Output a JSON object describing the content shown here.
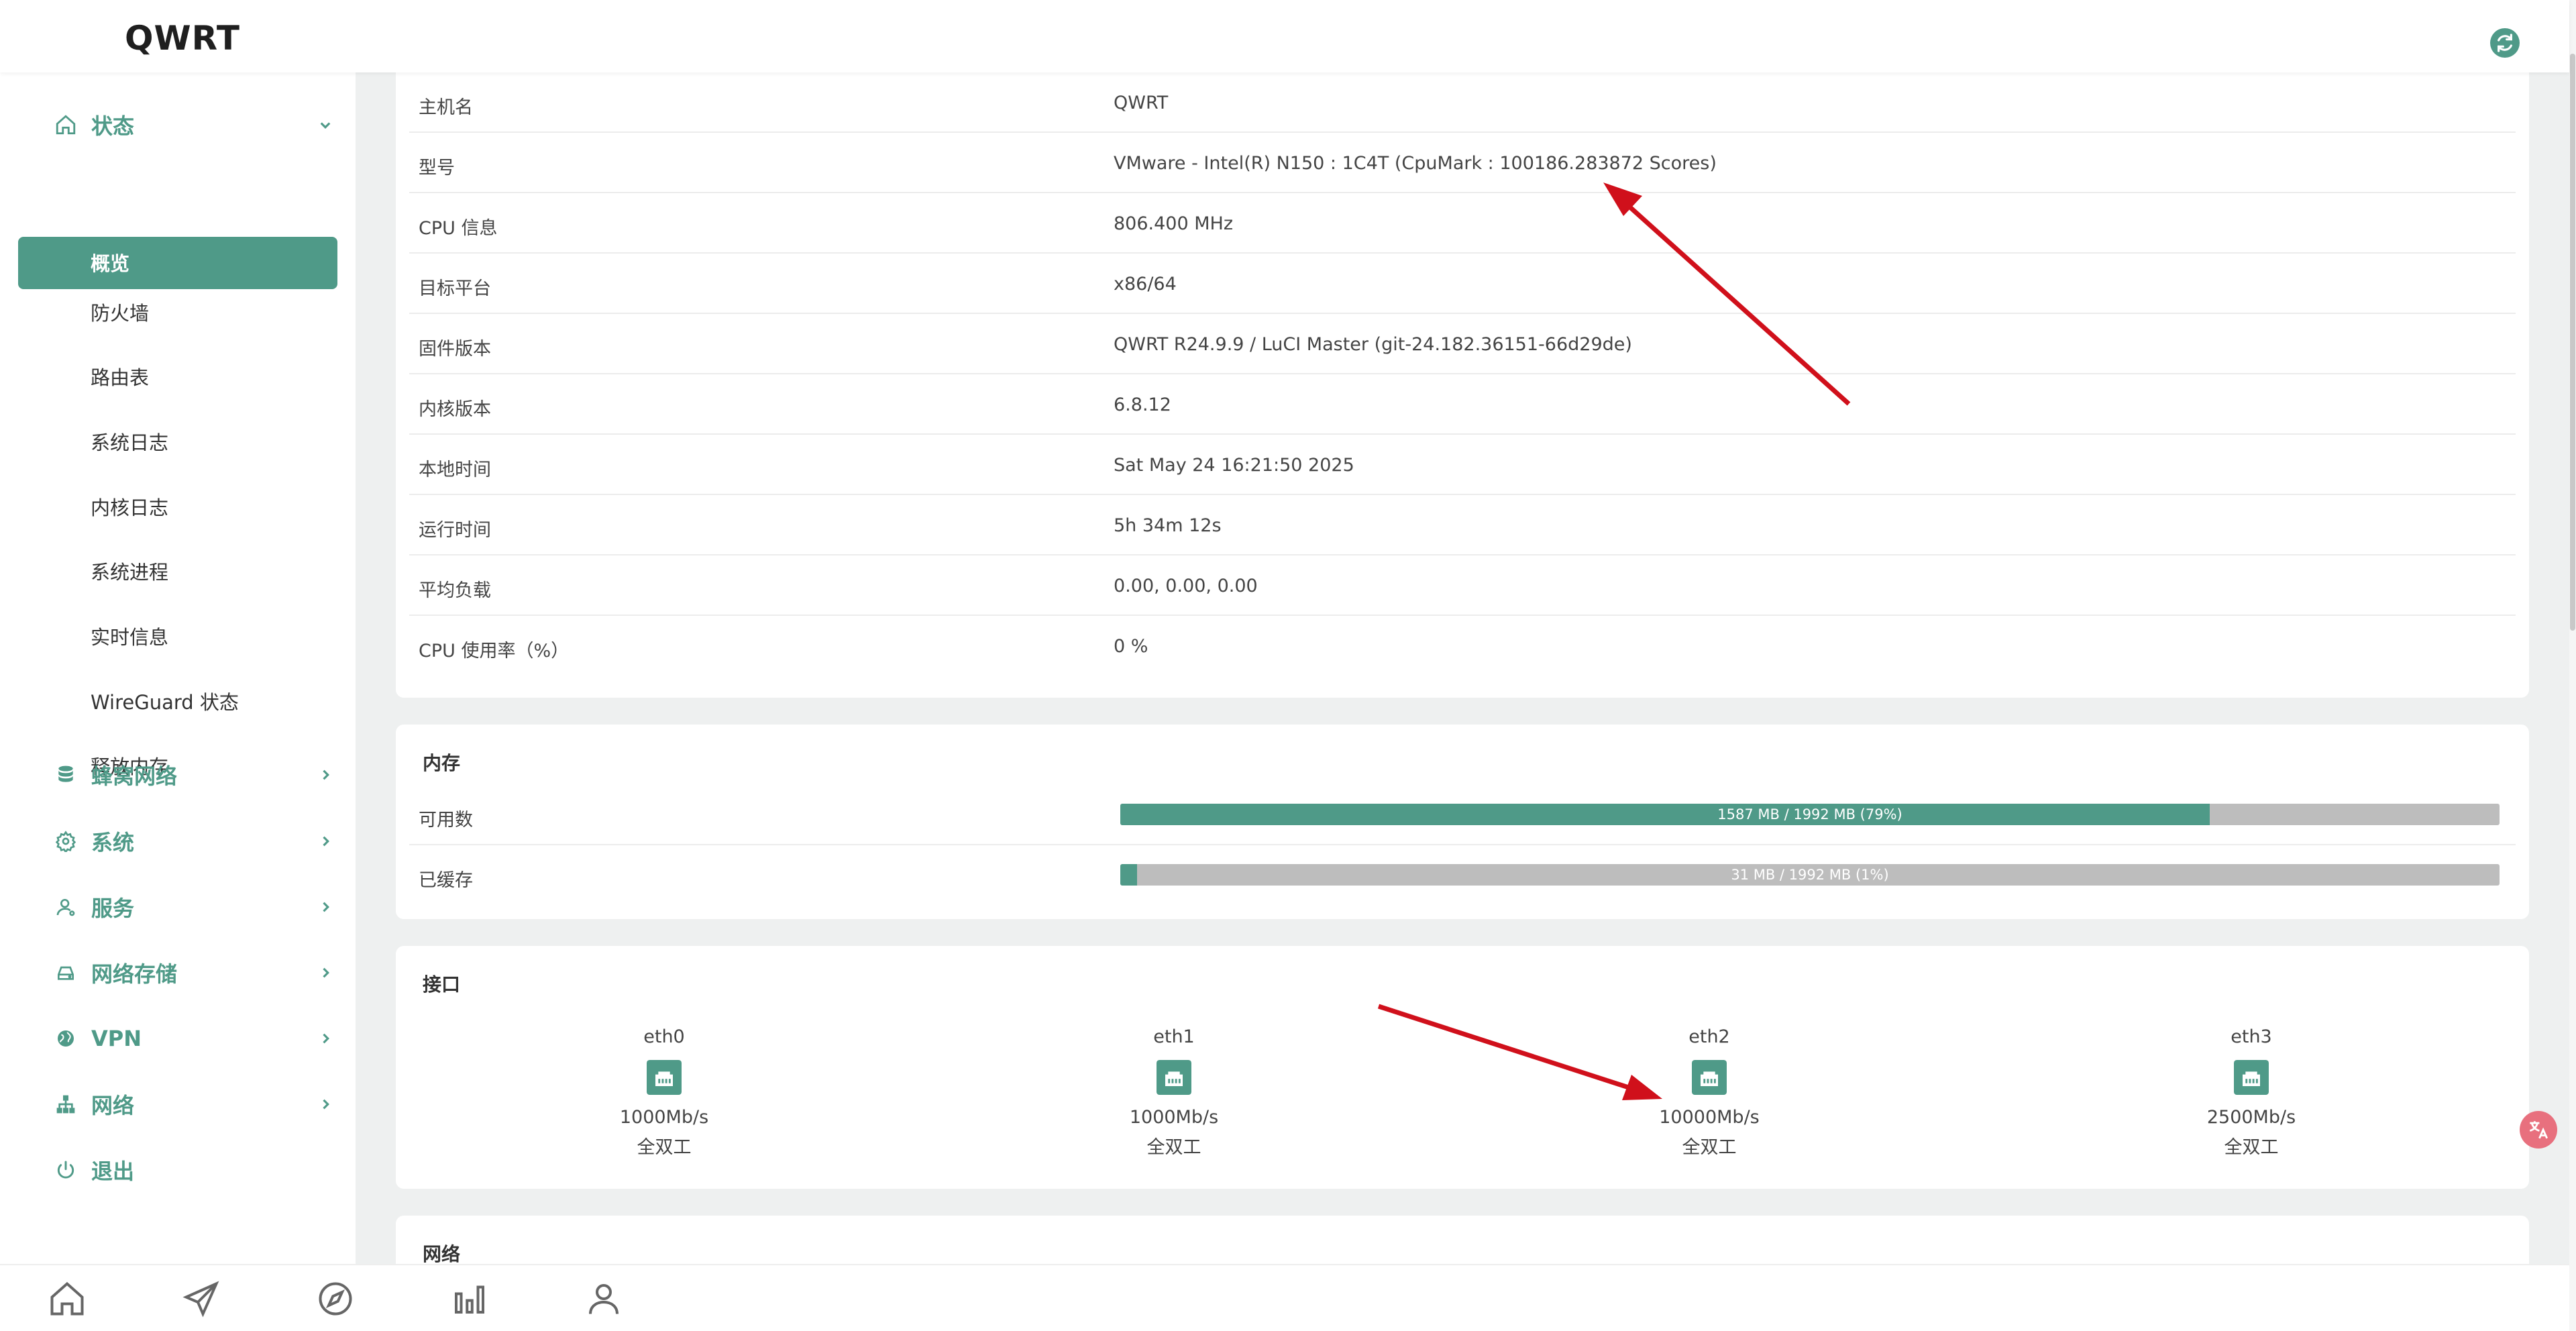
{
  "header": {
    "brand": "QWRT"
  },
  "sidebar": {
    "status_group": "状态",
    "status_items": [
      "概览",
      "防火墙",
      "路由表",
      "系统日志",
      "内核日志",
      "系统进程",
      "实时信息",
      "WireGuard 状态",
      "释放内存"
    ],
    "groups": [
      "蜂窝网络",
      "系统",
      "服务",
      "网络存储",
      "VPN",
      "网络",
      "退出"
    ]
  },
  "system": {
    "rows": [
      {
        "k": "主机名",
        "v": "QWRT"
      },
      {
        "k": "型号",
        "v": "VMware - Intel(R) N150 : 1C4T (CpuMark : 100186.283872 Scores)"
      },
      {
        "k": "CPU 信息",
        "v": "806.400 MHz"
      },
      {
        "k": "目标平台",
        "v": "x86/64"
      },
      {
        "k": "固件版本",
        "v": "QWRT R24.9.9 / LuCI Master (git-24.182.36151-66d29de)"
      },
      {
        "k": "内核版本",
        "v": "6.8.12"
      },
      {
        "k": "本地时间",
        "v": "Sat May 24 16:21:50 2025"
      },
      {
        "k": "运行时间",
        "v": "5h 34m 12s"
      },
      {
        "k": "平均负载",
        "v": "0.00, 0.00, 0.00"
      },
      {
        "k": "CPU 使用率（%）",
        "v": "0 %"
      }
    ]
  },
  "memory": {
    "title": "内存",
    "rows": [
      {
        "k": "可用数",
        "text": "1587 MB / 1992 MB (79%)",
        "fraction": 0.79
      },
      {
        "k": "已缓存",
        "text": "31 MB / 1992 MB (1%)",
        "fraction": 0.01
      }
    ]
  },
  "interfaces": {
    "title": "接口",
    "items": [
      {
        "name": "eth0",
        "speed": "1000Mb/s",
        "duplex": "全双工"
      },
      {
        "name": "eth1",
        "speed": "1000Mb/s",
        "duplex": "全双工"
      },
      {
        "name": "eth2",
        "speed": "10000Mb/s",
        "duplex": "全双工"
      },
      {
        "name": "eth3",
        "speed": "2500Mb/s",
        "duplex": "全双工"
      }
    ]
  },
  "network": {
    "title": "网络"
  },
  "colors": {
    "accent": "#4f9a88",
    "annotation_arrow": "#d0101b"
  }
}
